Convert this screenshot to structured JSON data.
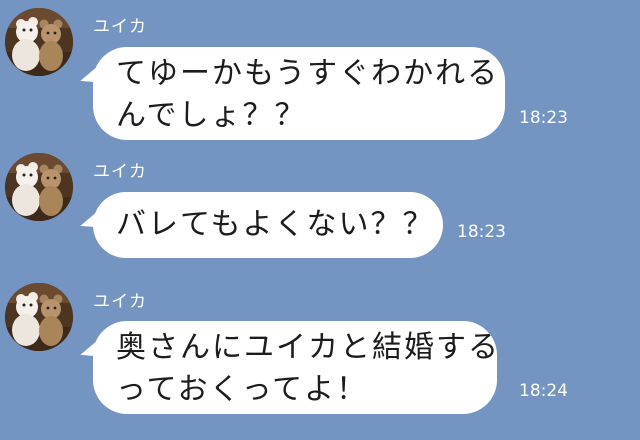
{
  "colors": {
    "chat_background": "#7494c2",
    "bubble": "#ffffff",
    "text": "#1c1c1c",
    "meta_text": "#ffffff"
  },
  "messages": [
    {
      "sender": "ユイカ",
      "avatar_icon": "teddy-bears-avatar-icon",
      "lines": [
        "てゆーかもうすぐわかれる",
        "んでしょ？？"
      ],
      "time": "18:23"
    },
    {
      "sender": "ユイカ",
      "avatar_icon": "teddy-bears-avatar-icon",
      "lines": [
        "バレてもよくない？？"
      ],
      "time": "18:23"
    },
    {
      "sender": "ユイカ",
      "avatar_icon": "teddy-bears-avatar-icon",
      "lines": [
        "奥さんにユイカと結婚する",
        "っておくってよ！"
      ],
      "time": "18:24"
    }
  ]
}
